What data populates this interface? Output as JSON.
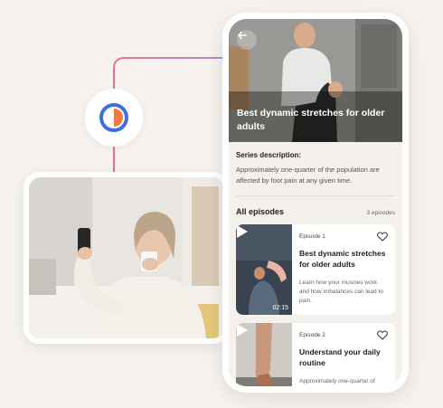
{
  "hero": {
    "title": "Best dynamic stretches for older adults"
  },
  "series": {
    "label": "Series description:",
    "text": "Approximately one-quarter of the population are affected by foot pain at any given time."
  },
  "episodes_header": {
    "title": "All episodes",
    "count": "3 episodes"
  },
  "episodes": [
    {
      "number": "Episode 1",
      "title": "Best dynamic stretches for older adults",
      "description": "Learn how your muscles work and how imbalances can lead to pain.",
      "duration": "02:15"
    },
    {
      "number": "Episode 2",
      "title": "Understand your daily routine",
      "description": "Approximately one-quarter of"
    }
  ],
  "colors": {
    "accent_pink": "#e8728a",
    "accent_purple": "#b08fd8",
    "logo_blue": "#3f6fe0",
    "logo_orange": "#f07a3c",
    "hero_overlay": "#3a3734"
  },
  "icons": {
    "back": "arrow-left-icon",
    "play": "play-icon",
    "favorite": "heart-outline-icon",
    "logo": "brand-logo-icon"
  }
}
